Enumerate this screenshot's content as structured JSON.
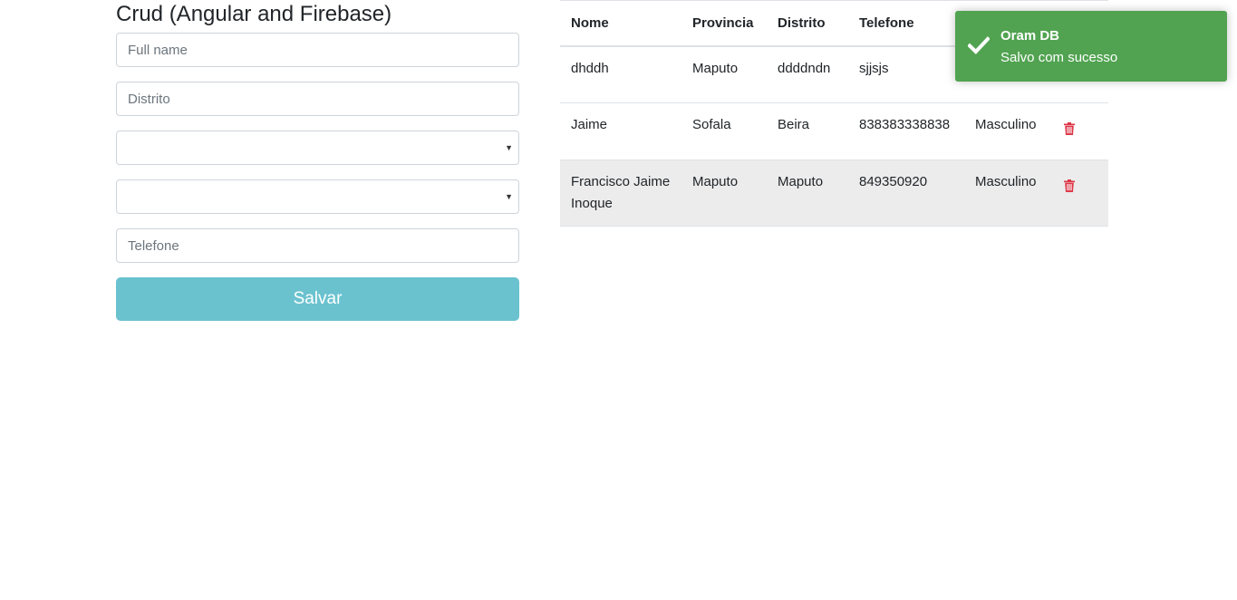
{
  "form": {
    "title": "Crud (Angular and Firebase)",
    "full_name": {
      "placeholder": "Full name",
      "value": ""
    },
    "distrito": {
      "placeholder": "Distrito",
      "value": ""
    },
    "provincia_select": {
      "value": ""
    },
    "genero_select": {
      "value": ""
    },
    "telefone": {
      "placeholder": "Telefone",
      "value": ""
    },
    "save_label": "Salvar"
  },
  "table": {
    "headers": [
      "Nome",
      "Provincia",
      "Distrito",
      "Telefone"
    ],
    "rows": [
      {
        "nome": "dhddh",
        "provincia": "Maputo",
        "distrito": "ddddndn",
        "telefone": "sjjsjs",
        "genero": ""
      },
      {
        "nome": "Jaime",
        "provincia": "Sofala",
        "distrito": "Beira",
        "telefone": "838383338838",
        "genero": "Masculino"
      },
      {
        "nome": "Francisco Jaime Inoque",
        "provincia": "Maputo",
        "distrito": "Maputo",
        "telefone": "849350920",
        "genero": "Masculino"
      }
    ]
  },
  "toast": {
    "title": "Oram DB",
    "message": "Salvo com sucesso",
    "icon": "checkmark-icon",
    "color": "#51a351"
  },
  "colors": {
    "save_button": "#6ac2cf",
    "delete_icon": "#dc3545",
    "highlight_row": "#ececec"
  }
}
